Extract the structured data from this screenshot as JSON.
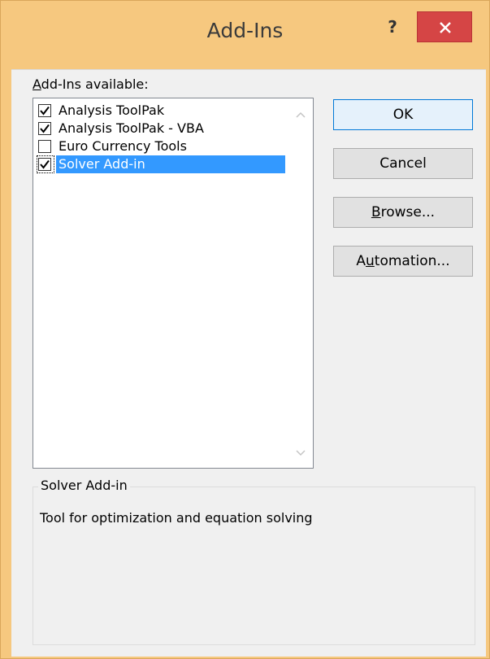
{
  "window": {
    "title": "Add-Ins",
    "help_label": "?",
    "close_icon": "close-icon"
  },
  "addins_available_label": "Add-Ins available:",
  "addins": [
    {
      "label": "Analysis ToolPak",
      "checked": true,
      "selected": false
    },
    {
      "label": "Analysis ToolPak - VBA",
      "checked": true,
      "selected": false
    },
    {
      "label": "Euro Currency Tools",
      "checked": false,
      "selected": false
    },
    {
      "label": "Solver Add-in",
      "checked": true,
      "selected": true
    }
  ],
  "buttons": {
    "ok": "OK",
    "cancel": "Cancel",
    "browse": "Browse...",
    "automation": "Automation..."
  },
  "description": {
    "title": "Solver Add-in",
    "text": "Tool for optimization and equation solving"
  },
  "colors": {
    "window_frame": "#f6c87f",
    "close_button": "#d54545",
    "selection": "#3399ff"
  }
}
